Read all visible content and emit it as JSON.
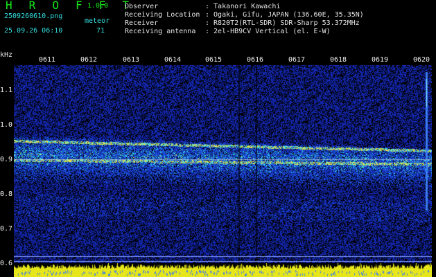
{
  "header": {
    "app_name": "H R O F F T",
    "version": "1.0.0",
    "filename": "2509260610.png",
    "timestamp": "25.09.26 06:10",
    "meteor_label": "meteor",
    "meteor_count": "71",
    "info": [
      {
        "label": "Observer",
        "value": ": Takanori Kawachi"
      },
      {
        "label": "Receiving Location",
        "value": ": Ogaki, Gifu, JAPAN (136.60E, 35.35N)"
      },
      {
        "label": "Receiver",
        "value": ": R820T2(RTL-SDR) SDR-Sharp 53.372MHz"
      },
      {
        "label": "Receiving antenna",
        "value": ": 2el-HB9CV Vertical (el. E-W)"
      }
    ]
  },
  "axes": {
    "y_unit": "kHz",
    "y_ticks": [
      "1.1",
      "1.0",
      "0.9",
      "0.8",
      "0.7",
      "0.6"
    ],
    "x_ticks": [
      "0611",
      "0612",
      "0613",
      "0614",
      "0615",
      "0616",
      "0617",
      "0618",
      "0619",
      "0620"
    ]
  },
  "colors": {
    "background": "#000000",
    "noise": "#1a2fc4",
    "signal": "#2de0e6",
    "peak": "#e8e838",
    "title": "#19e619",
    "info": "#33dede",
    "footer": "#e6e61a"
  }
}
